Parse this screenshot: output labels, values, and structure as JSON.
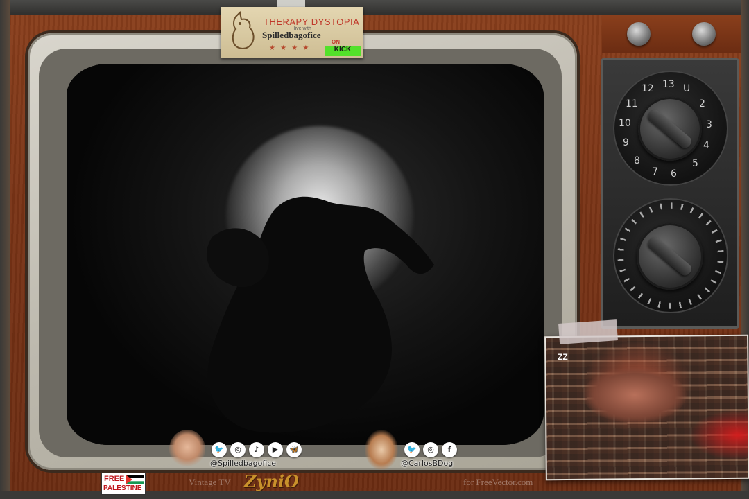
{
  "logo": {
    "title": "THERAPY DYSTOPIA",
    "small": "live with",
    "subtitle": "Spilledbagofice",
    "on": "ON",
    "badge": "KICK"
  },
  "cam": {
    "sleep_text": "ZZ"
  },
  "dial": {
    "numbers": [
      "12",
      "13",
      "U",
      "2",
      "3",
      "4",
      "5",
      "6",
      "7",
      "8",
      "9",
      "10",
      "11"
    ]
  },
  "social_left": {
    "handle": "@Spilledbagofice",
    "icons": [
      "twitter-icon",
      "instagram-icon",
      "tiktok-icon",
      "youtube-icon",
      "bluesky-icon"
    ]
  },
  "social_right": {
    "handle": "@CarlosBDog",
    "icons": [
      "twitter-icon",
      "instagram-icon",
      "facebook-icon"
    ]
  },
  "footer": {
    "free": "FREE",
    "palestine": "PALESTINE",
    "vintage": "Vintage TV",
    "brand": "ZyniO",
    "credit": "for FreeVector.com"
  },
  "colors": {
    "cabinet_wood": "#7a3416",
    "bezel": "#c9c5ba",
    "screen": "#050505",
    "logo_title": "#c0392b",
    "kick_green": "#53e12a",
    "brand_gold": "#c8912b"
  }
}
